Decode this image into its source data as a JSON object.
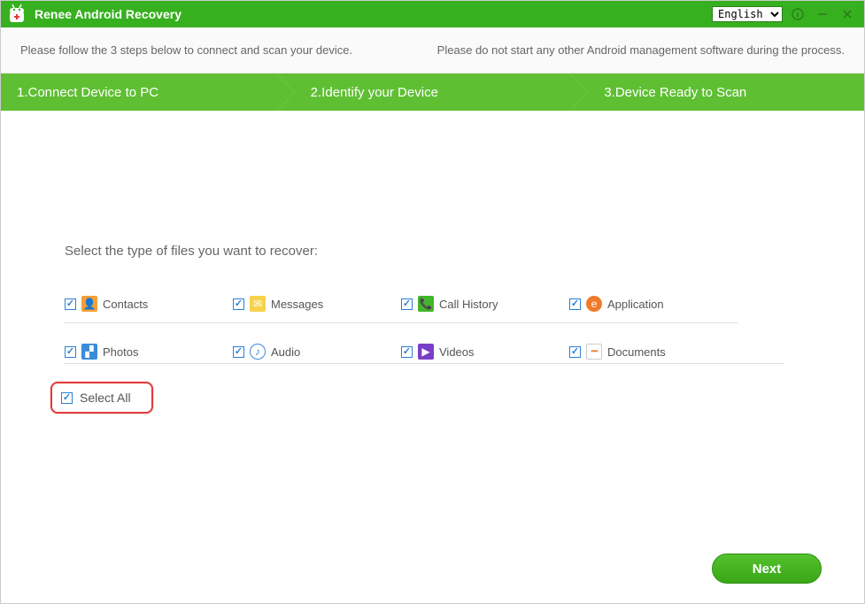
{
  "titlebar": {
    "app_title": "Renee Android Recovery",
    "language_selected": "English"
  },
  "instructions": {
    "left": "Please follow the 3 steps below to connect and scan your device.",
    "right": "Please do not start any other Android management software during the process."
  },
  "steps": [
    "1.Connect Device to PC",
    "2.Identify your Device",
    "3.Device Ready to Scan"
  ],
  "main": {
    "prompt": "Select the type of files you want to recover:",
    "file_types": [
      {
        "label": "Contacts",
        "icon": "contacts",
        "checked": true
      },
      {
        "label": "Messages",
        "icon": "messages",
        "checked": true
      },
      {
        "label": "Call History",
        "icon": "call",
        "checked": true
      },
      {
        "label": "Application",
        "icon": "app",
        "checked": true
      },
      {
        "label": "Photos",
        "icon": "photos",
        "checked": true
      },
      {
        "label": "Audio",
        "icon": "audio",
        "checked": true
      },
      {
        "label": "Videos",
        "icon": "videos",
        "checked": true
      },
      {
        "label": "Documents",
        "icon": "docs",
        "checked": true
      }
    ],
    "select_all_label": "Select All",
    "select_all_checked": true,
    "next_label": "Next"
  },
  "icons": {
    "contacts": "👤",
    "messages": "✉",
    "call": "📞",
    "app": "e",
    "photos": "▞",
    "audio": "♪",
    "videos": "▶",
    "docs_dots": "••••"
  },
  "colors": {
    "brand_green": "#37b020",
    "step_green": "#5fbf33",
    "highlight_red": "#e23b3b",
    "checkbox_blue": "#2b7fd6"
  }
}
